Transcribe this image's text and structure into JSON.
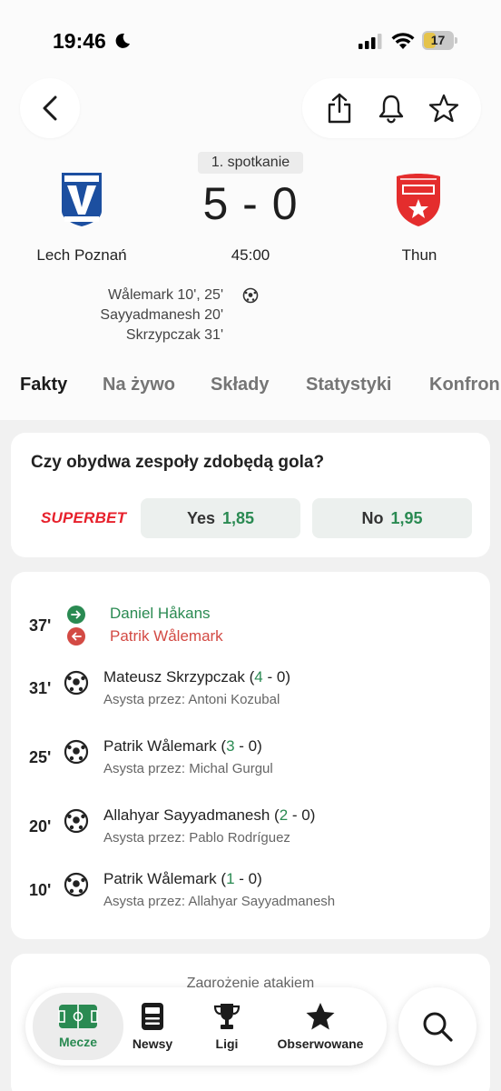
{
  "status_bar": {
    "time": "19:46",
    "battery": "17"
  },
  "match": {
    "round": "1. spotkanie",
    "score": "5 - 0",
    "time": "45:00",
    "home": {
      "name": "Lech Poznań"
    },
    "away": {
      "name": "Thun"
    },
    "scorers": [
      "Wålemark 10', 25'",
      "Sayyadmanesh 20'",
      "Skrzypczak 31'"
    ]
  },
  "tabs": [
    "Fakty",
    "Na żywo",
    "Składy",
    "Statystyki",
    "Konfron"
  ],
  "bet": {
    "question": "Czy obydwa zespoły zdobędą gola?",
    "bookmaker": "SUPERBET",
    "options": [
      {
        "label": "Yes",
        "odds": "1,85"
      },
      {
        "label": "No",
        "odds": "1,95"
      }
    ]
  },
  "events": {
    "substitution": {
      "minute": "37'",
      "in": "Daniel Håkans",
      "out": "Patrik Wålemark"
    },
    "goals": [
      {
        "minute": "31'",
        "player": "Mateusz Skrzypczak",
        "score_home": "4",
        "score_rest": " - 0",
        "assist": "Asysta przez: Antoni Kozubal"
      },
      {
        "minute": "25'",
        "player": "Patrik Wålemark",
        "score_home": "3",
        "score_rest": " - 0",
        "assist": "Asysta przez: Michal Gurgul"
      },
      {
        "minute": "20'",
        "player": "Allahyar Sayyadmanesh",
        "score_home": "2",
        "score_rest": " - 0",
        "assist": "Asysta przez: Pablo Rodríguez"
      },
      {
        "minute": "10'",
        "player": "Patrik Wålemark",
        "score_home": "1",
        "score_rest": " - 0",
        "assist": "Asysta przez: Allahyar Sayyadmanesh"
      }
    ]
  },
  "next_card": {
    "title": "Zagrożenie atakiem"
  },
  "nav": {
    "items": [
      {
        "label": "Mecze",
        "icon": "pitch-icon"
      },
      {
        "label": "Newsy",
        "icon": "newspaper-icon"
      },
      {
        "label": "Ligi",
        "icon": "trophy-icon"
      },
      {
        "label": "Obserwowane",
        "icon": "star-icon"
      }
    ],
    "search_icon": "search-icon"
  },
  "colors": {
    "accent_green": "#2a8a52",
    "sub_out_red": "#d34a44",
    "superbet_red": "#e7212c"
  }
}
